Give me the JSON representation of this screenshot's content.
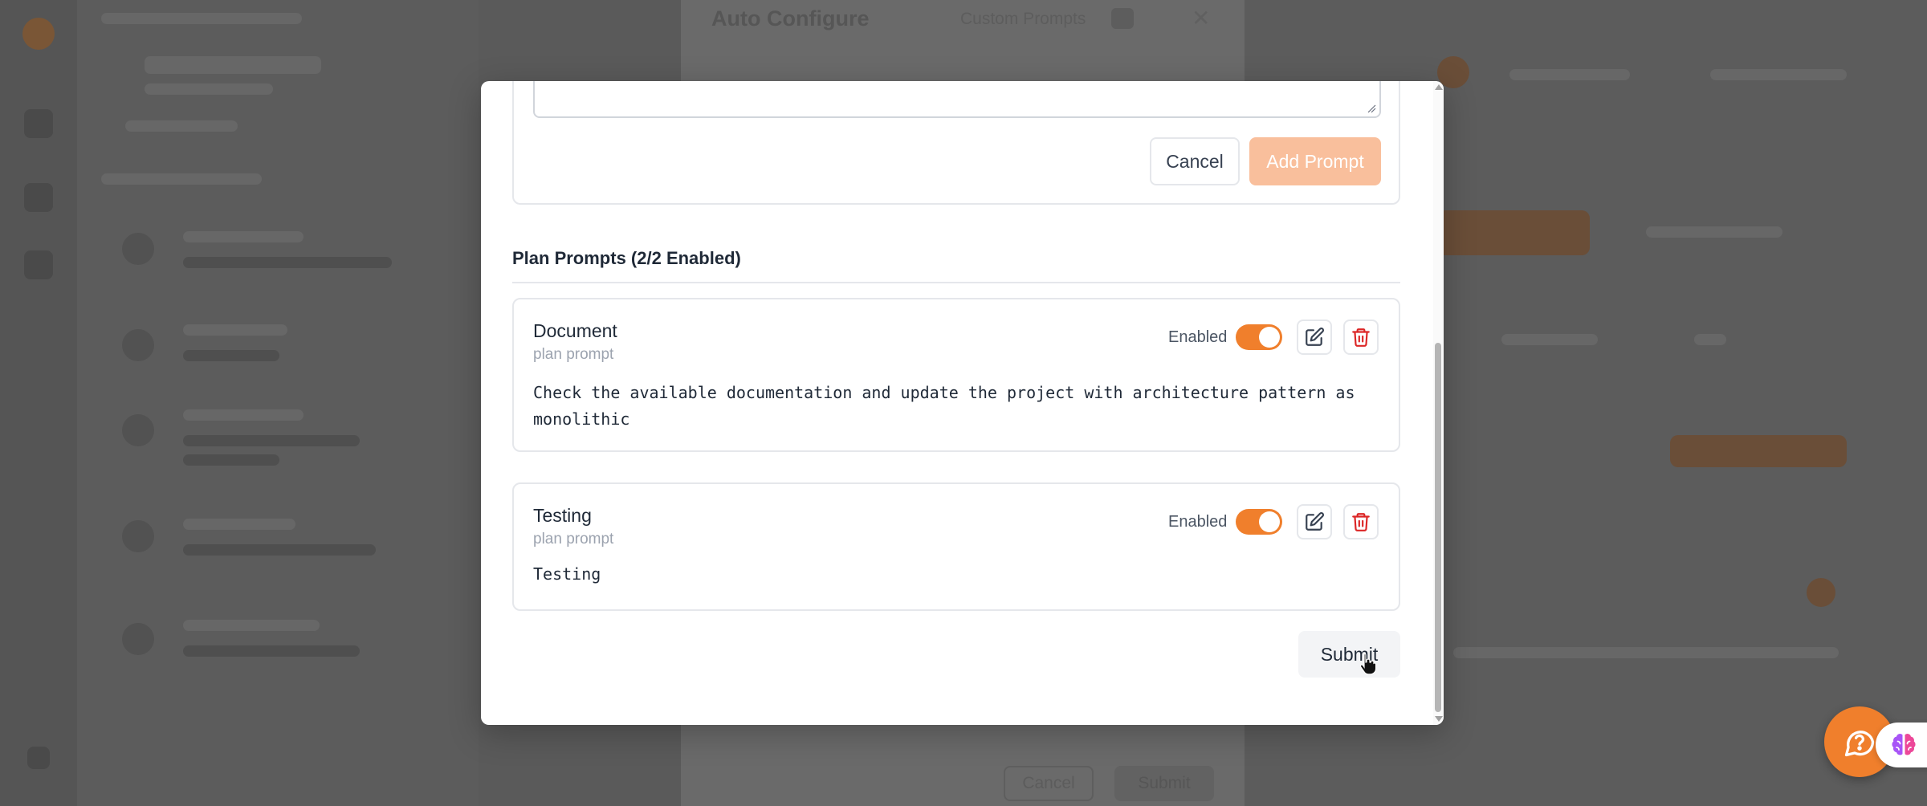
{
  "background": {
    "dialog_title": "Auto Configure",
    "dialog_tab": "Custom Prompts",
    "cancel_label": "Cancel",
    "submit_label": "Submit"
  },
  "form": {
    "cancel_label": "Cancel",
    "add_label": "Add Prompt"
  },
  "section": {
    "title": "Plan Prompts (2/2 Enabled)"
  },
  "prompts": [
    {
      "name": "Document",
      "type": "plan prompt",
      "status": "Enabled",
      "enabled": true,
      "text": "Check the available documentation and update the project with architecture pattern as monolithic"
    },
    {
      "name": "Testing",
      "type": "plan prompt",
      "status": "Enabled",
      "enabled": true,
      "text": "Testing"
    }
  ],
  "actions": {
    "submit_label": "Submit"
  },
  "icons": {
    "edit": "edit-icon",
    "delete": "trash-icon",
    "help": "help-chat-icon",
    "brain": "brain-icon"
  },
  "colors": {
    "accent": "#f07f2c",
    "accent_disabled": "#f9bf9c",
    "danger": "#dc2626"
  }
}
